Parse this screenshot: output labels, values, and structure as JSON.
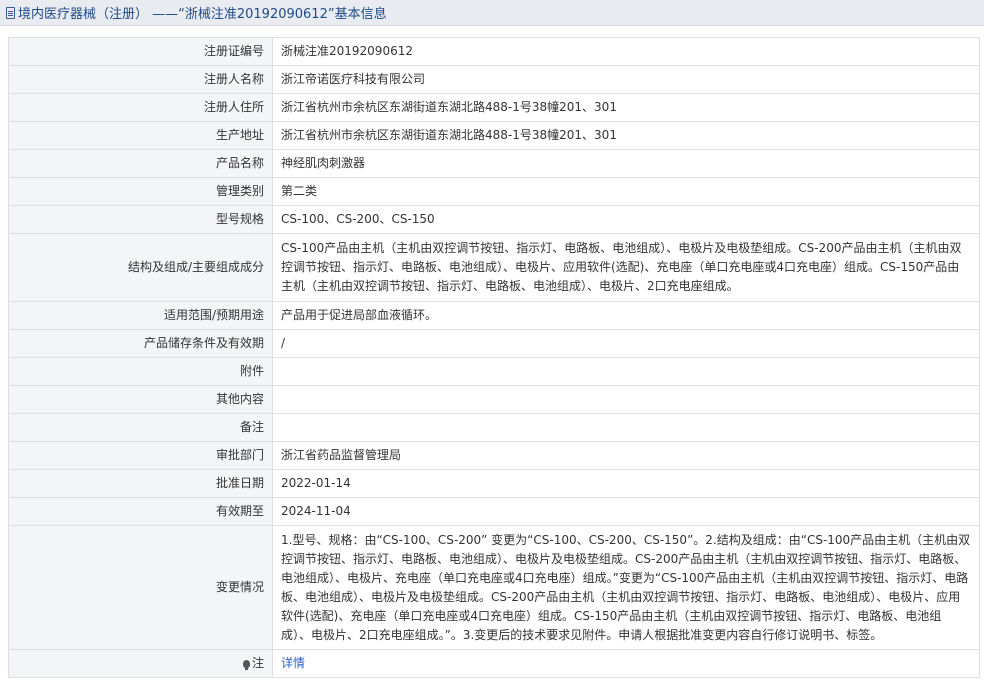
{
  "header": {
    "icon": "document-icon",
    "title": "境内医疗器械（注册） ——“浙械注准20192090612”基本信息"
  },
  "rows": [
    {
      "label": "注册证编号",
      "value": "浙械注准20192090612"
    },
    {
      "label": "注册人名称",
      "value": "浙江帝诺医疗科技有限公司"
    },
    {
      "label": "注册人住所",
      "value": "浙江省杭州市余杭区东湖街道东湖北路488-1号38幢201、301"
    },
    {
      "label": "生产地址",
      "value": "浙江省杭州市余杭区东湖街道东湖北路488-1号38幢201、301"
    },
    {
      "label": "产品名称",
      "value": "神经肌肉刺激器"
    },
    {
      "label": "管理类别",
      "value": "第二类"
    },
    {
      "label": "型号规格",
      "value": "CS-100、CS-200、CS-150"
    },
    {
      "label": "结构及组成/主要组成成分",
      "value": "CS-100产品由主机（主机由双控调节按钮、指示灯、电路板、电池组成）、电极片及电极垫组成。CS-200产品由主机（主机由双控调节按钮、指示灯、电路板、电池组成）、电极片、应用软件(选配)、充电座（单口充电座或4口充电座）组成。CS-150产品由主机（主机由双控调节按钮、指示灯、电路板、电池组成）、电极片、2口充电座组成。"
    },
    {
      "label": "适用范围/预期用途",
      "value": "产品用于促进局部血液循环。"
    },
    {
      "label": "产品储存条件及有效期",
      "value": "/"
    },
    {
      "label": "附件",
      "value": ""
    },
    {
      "label": "其他内容",
      "value": ""
    },
    {
      "label": "备注",
      "value": ""
    },
    {
      "label": "审批部门",
      "value": "浙江省药品监督管理局"
    },
    {
      "label": "批准日期",
      "value": "2022-01-14"
    },
    {
      "label": "有效期至",
      "value": "2024-11-04"
    },
    {
      "label": "变更情况",
      "value": "1.型号、规格：由“CS-100、CS-200” 变更为“CS-100、CS-200、CS-150”。2.结构及组成：由“CS-100产品由主机（主机由双控调节按钮、指示灯、电路板、电池组成）、电极片及电极垫组成。CS-200产品由主机（主机由双控调节按钮、指示灯、电路板、电池组成）、电极片、充电座（单口充电座或4口充电座）组成。”变更为“CS-100产品由主机（主机由双控调节按钮、指示灯、电路板、电池组成）、电极片及电极垫组成。CS-200产品由主机（主机由双控调节按钮、指示灯、电路板、电池组成）、电极片、应用软件(选配)、充电座（单口充电座或4口充电座）组成。CS-150产品由主机（主机由双控调节按钮、指示灯、电路板、电池组成）、电极片、2口充电座组成。”。3.变更后的技术要求见附件。申请人根据批准变更内容自行修订说明书、标签。"
    }
  ],
  "note": {
    "icon": "lightbulb-icon",
    "label": "注",
    "link_text": "详情"
  }
}
